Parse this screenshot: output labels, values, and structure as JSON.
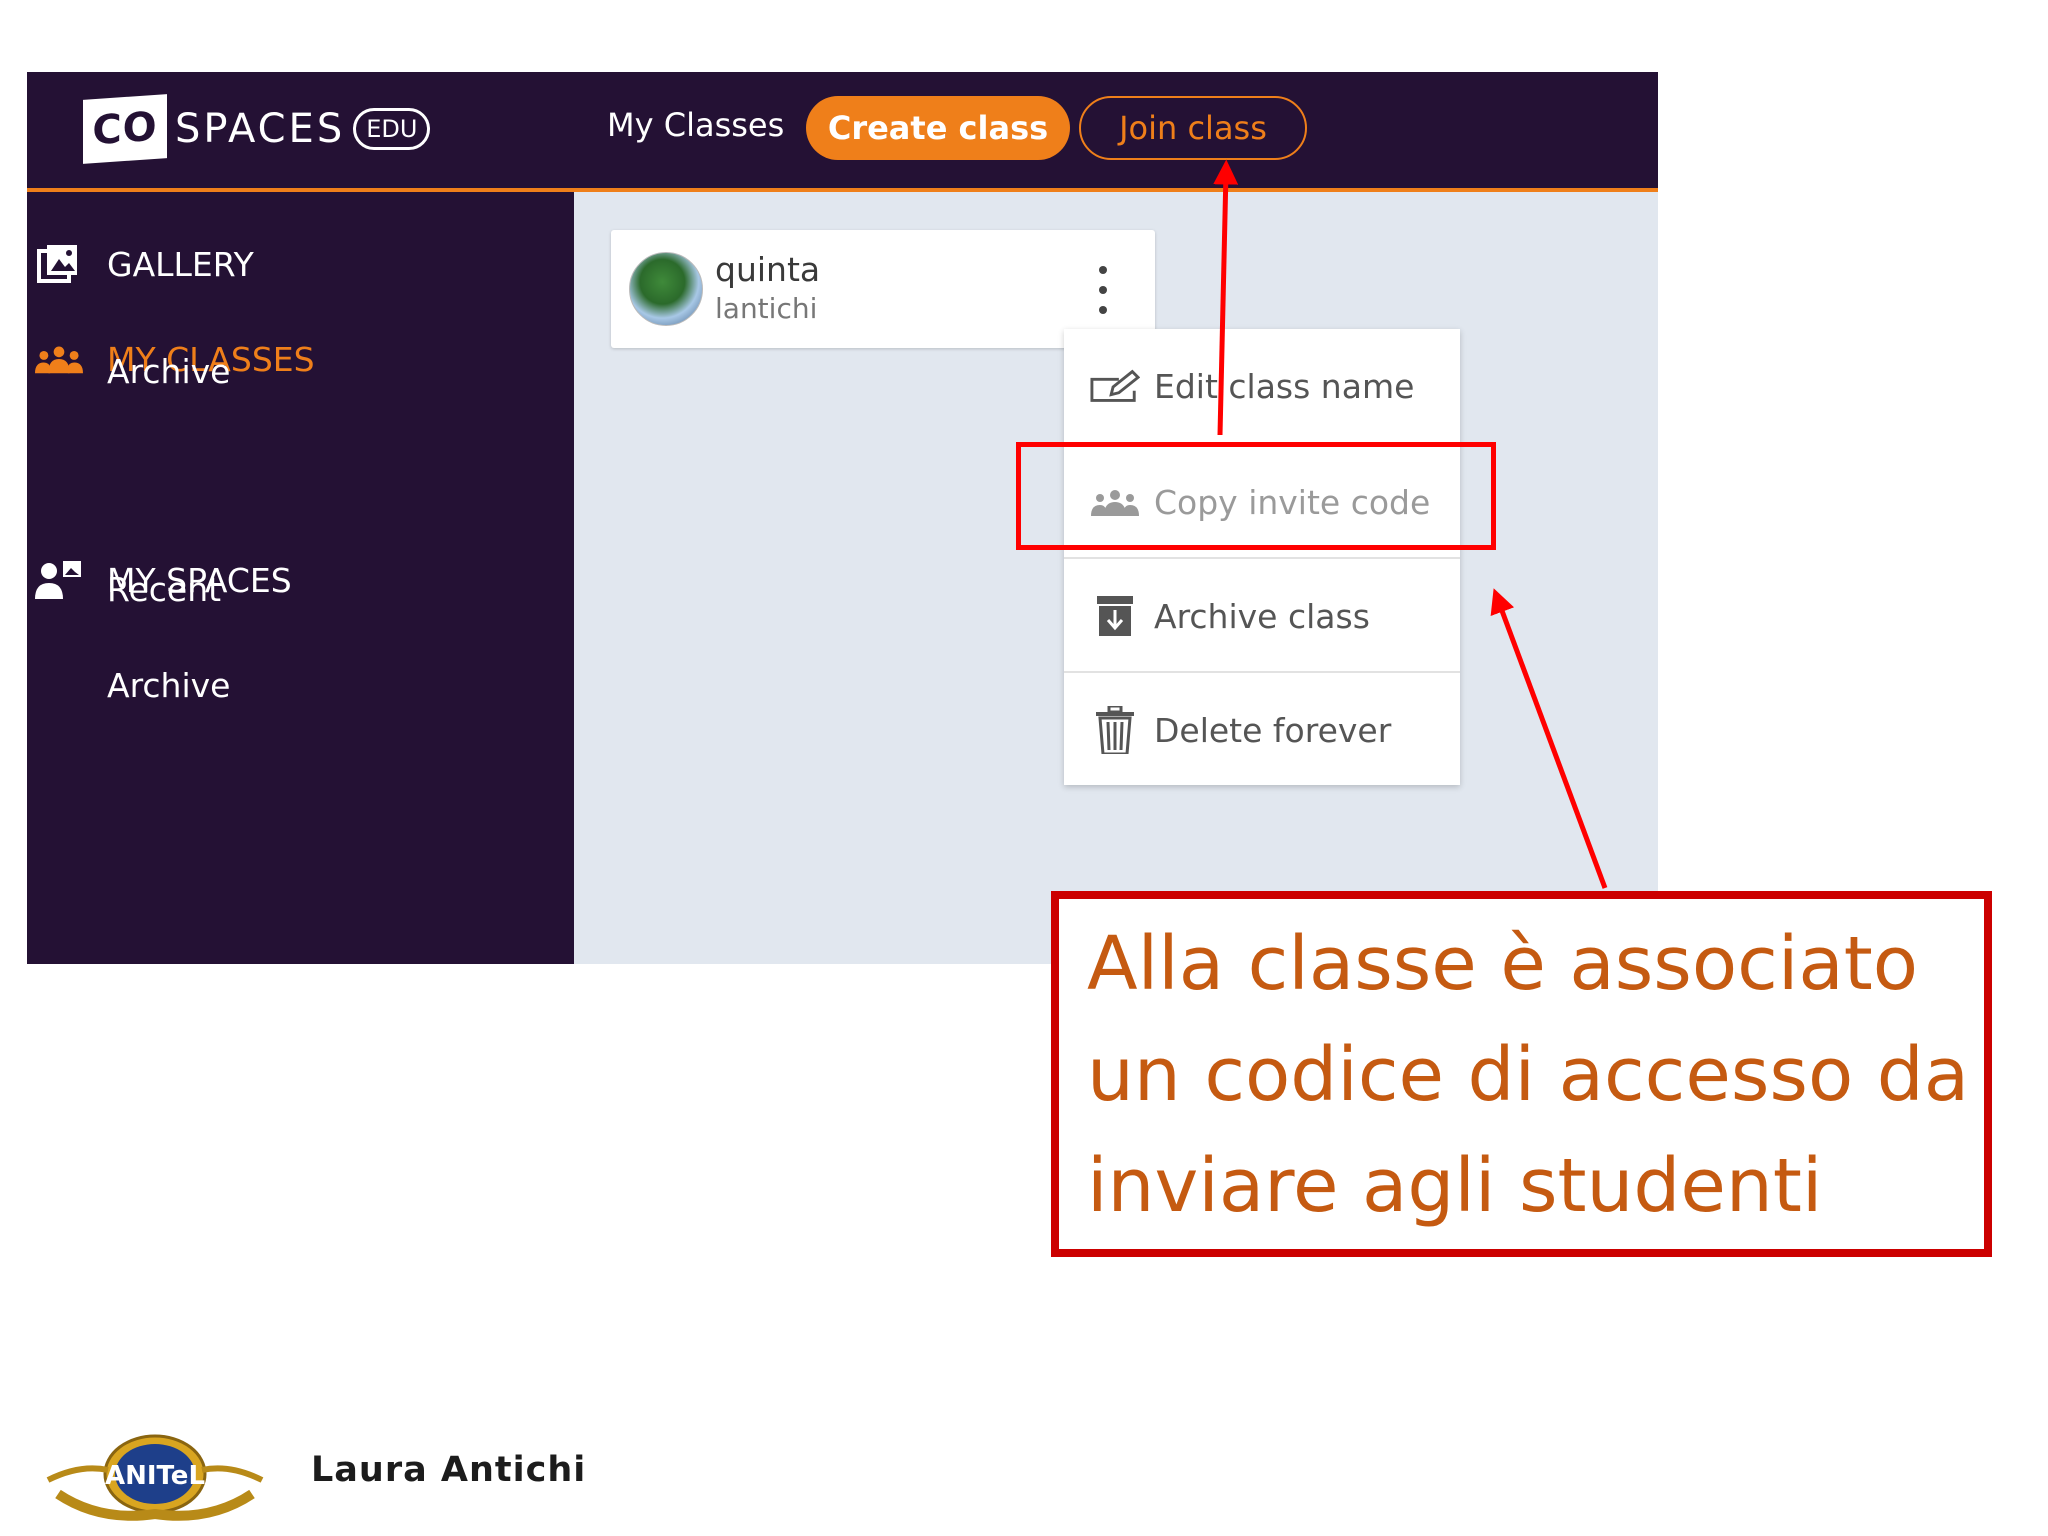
{
  "app": {
    "logo": {
      "box_text": "CO",
      "word": "SPACES",
      "edu": "EDU"
    },
    "header": {
      "nav_label": "My Classes",
      "create_button": "Create class",
      "join_button": "Join class"
    },
    "sidebar": {
      "gallery": "GALLERY",
      "my_classes": "MY CLASSES",
      "classes_archive": "Archive",
      "my_spaces": "MY SPACES",
      "recent": "Recent",
      "spaces_archive": "Archive"
    },
    "class_card": {
      "name": "quinta",
      "owner": "lantichi"
    },
    "context_menu": {
      "edit": "Edit class name",
      "copy": "Copy invite code",
      "archive": "Archive class",
      "delete": "Delete forever"
    },
    "colors": {
      "header_bg": "#241134",
      "accent": "#ef7f1a",
      "content_bg": "#e1e7ef"
    }
  },
  "annotation": {
    "callout_text": "Alla classe è associato un codice di accesso da inviare agli studenti",
    "highlight_color": "#ff0000",
    "text_color": "#c55a11"
  },
  "footer": {
    "author": "Laura Antichi",
    "logo_text": "ANITeL"
  }
}
